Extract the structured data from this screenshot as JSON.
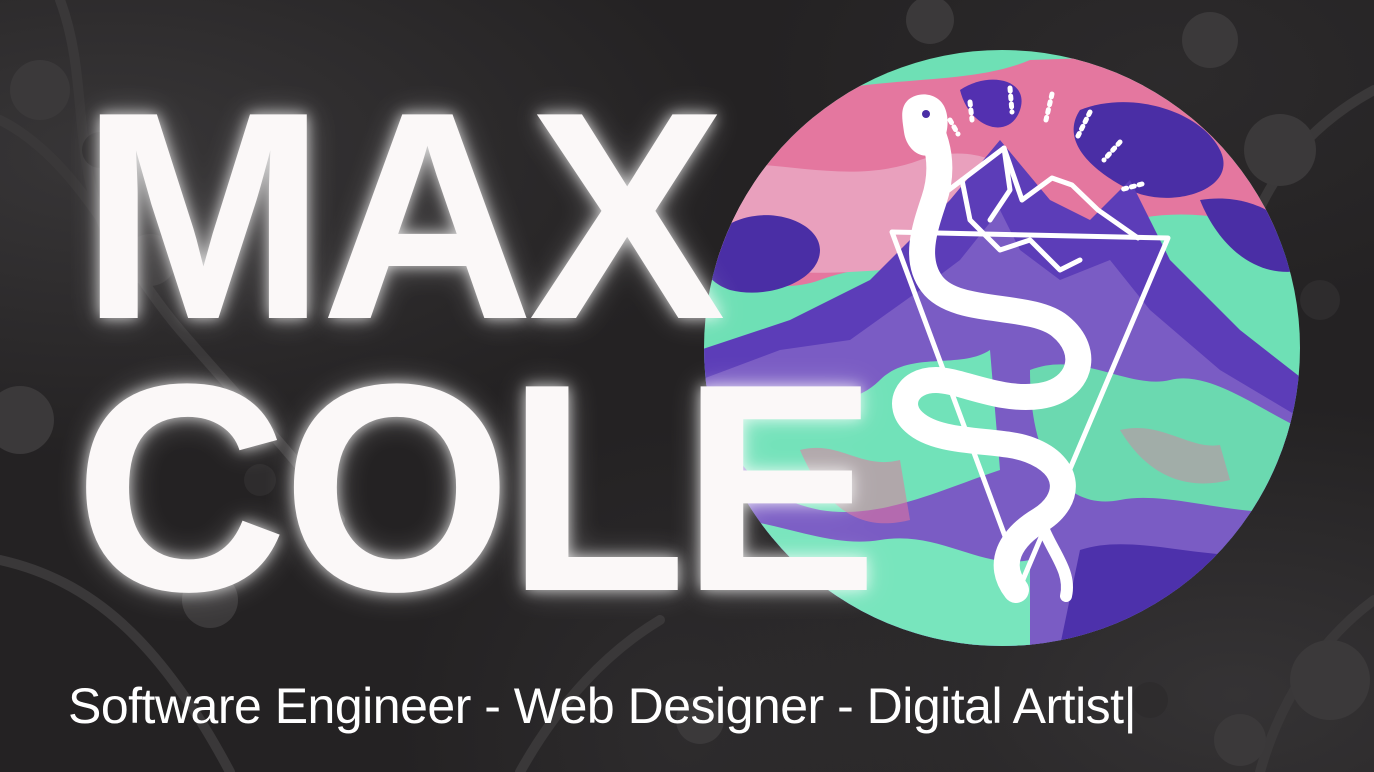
{
  "hero": {
    "first_name": "MAX",
    "last_name": "COLE",
    "tagline": "Software Engineer - Web Designer - Digital Artist",
    "cursor": "|"
  },
  "colors": {
    "background": "#242223",
    "name_text": "#fbf8f8",
    "mint": "#6fe3b6",
    "pink": "#e4769e",
    "purple": "#4b2fa6"
  },
  "icons": {
    "emblem": "snake-mountain-icon",
    "background": "cherry-blossom-branches"
  }
}
